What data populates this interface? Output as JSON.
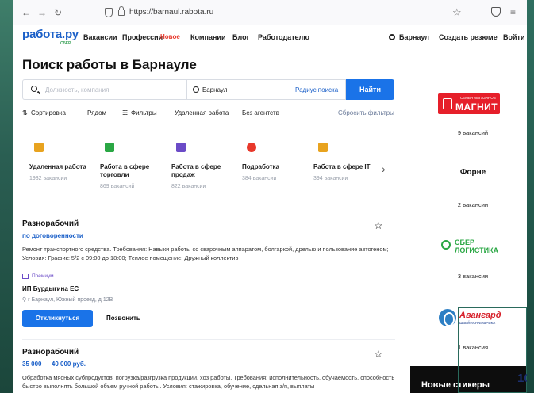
{
  "browser": {
    "url": "https://barnaul.rabota.ru"
  },
  "header": {
    "logo": "работа.ру",
    "logo_sub": "СБЕР",
    "nav": [
      "Вакансии",
      "Профессии",
      "Компании",
      "Блог",
      "Работодателю"
    ],
    "new_badge": "Новое",
    "region": "Барнаул",
    "create_resume": "Создать резюме",
    "login": "Войти"
  },
  "page": {
    "title": "Поиск работы в Барнауле"
  },
  "search": {
    "placeholder": "Должность, компания",
    "city": "Барнаул",
    "radius": "Радиус поиска",
    "submit": "Найти"
  },
  "filters": {
    "sort": "Сортировка",
    "nearby": "Рядом",
    "filters": "Фильтры",
    "remote": "Удаленная работа",
    "no_agencies": "Без агентств",
    "reset": "Сбросить фильтры"
  },
  "categories": [
    {
      "title": "Удаленная работа",
      "count": "1932 вакансии",
      "color": "#e8a31f"
    },
    {
      "title": "Работа в сфере торговли",
      "count": "869 вакансий",
      "color": "#2aa744"
    },
    {
      "title": "Работа в сфере продаж",
      "count": "822 вакансии",
      "color": "#6b4bc7"
    },
    {
      "title": "Подработка",
      "count": "384 вакансии",
      "color": "#e8382b"
    },
    {
      "title": "Работа в сфере IT",
      "count": "394 вакансии",
      "color": "#e8a31f"
    }
  ],
  "vacancies": [
    {
      "title": "Разнорабочий",
      "salary": "по договоренности",
      "description": "Ремонт транспортного средства. Требования: Навыки работы со сварочным аппаратом, болгаркой, дрелью и пользование автогеном; Условия: График: 5/2 с 09:00 до 18:00; Теплое помещение; Дружный коллектив",
      "premium": "Премиум",
      "employer": "ИП Бурдыгина ЕС",
      "address": "г Барнаул, Южный проезд, д 12В",
      "respond": "Откликнуться",
      "call": "Позвонить"
    },
    {
      "title": "Разнорабочий",
      "salary": "35 000 — 40 000 руб.",
      "description": "Обработка мясных субпродуктов, погрузка/разгрузка продукции, хоз работы. Требования: исполнительность, обучаемость, способность быстро выполнять большой объем ручной работы. Условия: стажировка, обучение, сдельная з/п, выплаты"
    }
  ],
  "sidebar": {
    "magnit_small": "СЕМЬЯ МАГАЗИНОВ",
    "magnit_big": "МАГНИТ",
    "magnit_count": "9 вакансий",
    "forne": "Форне",
    "forne_count": "2 вакансии",
    "sber_line1": "СБЕР",
    "sber_line2": "ЛОГИСТИКА",
    "sber_count": "3 вакансии",
    "avangard": "Авангард",
    "avangard_sub": "ШВЕЙНАЯ ФАБРИКА",
    "avangard_count": "1 вакансия"
  },
  "sticker": "Новые стикеры",
  "overlay_number": "10"
}
